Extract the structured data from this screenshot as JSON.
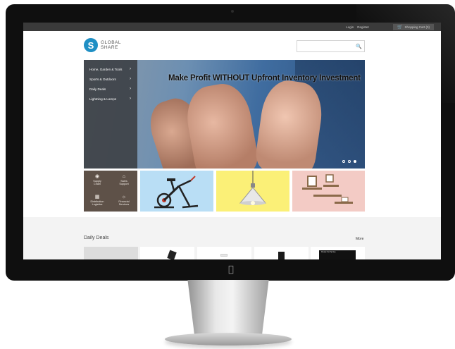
{
  "topbar": {
    "login": "Login",
    "register": "Register",
    "cart": "Shopping Cart (0)"
  },
  "logo": {
    "line1": "GLOBAL",
    "line2": "SHARE",
    "mark": "S"
  },
  "search": {
    "placeholder": "",
    "icon": "search-icon"
  },
  "hero": {
    "title": "Make Profit WITHOUT Upfront Inventory Investment",
    "slides": 3,
    "active_slide": 3
  },
  "categories": [
    {
      "label": "Home, Garden & Tools"
    },
    {
      "label": "Sports & Outdoors"
    },
    {
      "label": "Daily Deals"
    },
    {
      "label": "Lightning & Lamps"
    }
  ],
  "services": [
    {
      "icon": "globe-icon",
      "line1": "Supply",
      "line2": "Chain"
    },
    {
      "icon": "bank-icon",
      "line1": "Sales",
      "line2": "Support"
    },
    {
      "icon": "building-icon",
      "line1": "Distribution",
      "line2": "Logistics"
    },
    {
      "icon": "lightbulb-icon",
      "line1": "Financial",
      "line2": "Services"
    }
  ],
  "deals": {
    "title": "Daily Deals",
    "more": "More",
    "product5_text": "Ready Set Spring"
  },
  "colors": {
    "logo_blue": "#1f8fc4",
    "topbar": "#3a3a3a",
    "services_bg": "#5e5148",
    "tile_bike": "#b9def5",
    "tile_lamp": "#fbf077",
    "tile_shelf": "#f3cbc5"
  }
}
